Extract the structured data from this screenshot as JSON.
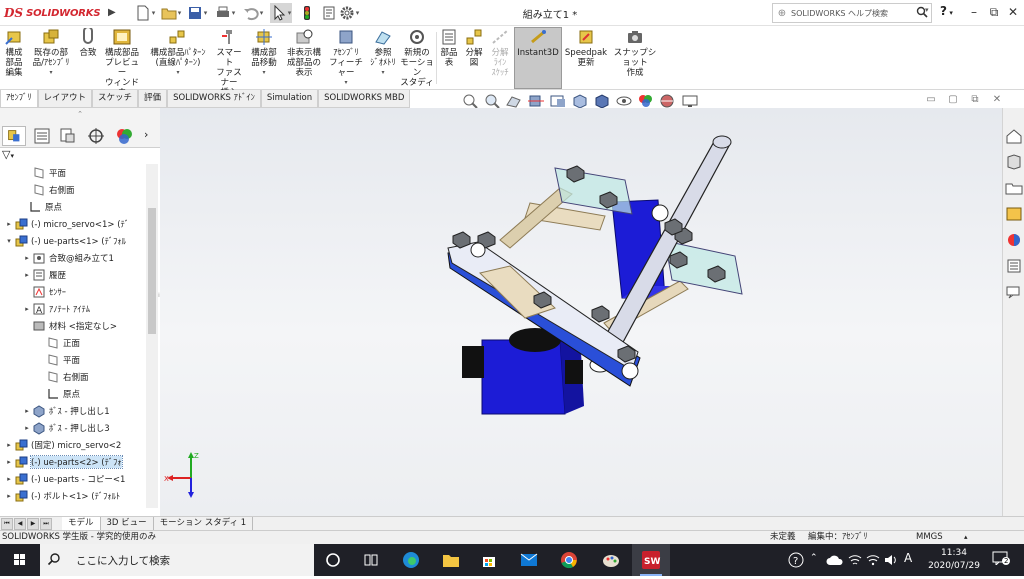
{
  "app": {
    "logo_mark": "DS",
    "logo_text": "SOLIDWORKS",
    "document_title": "組み立て1 *",
    "help_search_placeholder": "SOLIDWORKS ヘルプ検索",
    "help_label": "?",
    "accent_color": "#d3262f"
  },
  "ribbon": {
    "buttons": [
      {
        "label": "構成\n部品\n編集",
        "icon": "edit-component-icon"
      },
      {
        "label": "既存の部\n品/ｱｾﾝﾌﾞﾘ",
        "icon": "insert-component-icon"
      },
      {
        "label": "合致",
        "icon": "mate-icon"
      },
      {
        "label": "構成部品\nプレビュー\nウィンドウ",
        "icon": "preview-window-icon"
      },
      {
        "label": "構成部品ﾊﾟﾀｰﾝ\n(直線ﾊﾟﾀｰﾝ)",
        "icon": "linear-pattern-icon"
      },
      {
        "label": "スマート\nファスナー\n挿入",
        "icon": "smart-fastener-icon"
      },
      {
        "label": "構成部\n品移動",
        "icon": "move-component-icon"
      },
      {
        "label": "非表示構\n成部品の\n表示",
        "icon": "show-hidden-icon"
      },
      {
        "label": "ｱｾﾝﾌﾞﾘ\nフィーチャー",
        "icon": "assembly-feature-icon"
      },
      {
        "label": "参照\nｼﾞｵﾒﾄﾘ",
        "icon": "reference-geometry-icon"
      },
      {
        "label": "新規の\nモーション\nスタディ",
        "icon": "motion-study-icon"
      },
      {
        "label": "部品\n表",
        "icon": "bom-icon"
      },
      {
        "label": "分解\n図",
        "icon": "exploded-view-icon"
      },
      {
        "label": "分解\nﾗｲﾝ\nｽｹｯﾁ",
        "icon": "explode-line-icon"
      },
      {
        "label": "Instant3D",
        "icon": "instant3d-icon"
      },
      {
        "label": "Speedpak\n更新",
        "icon": "speedpak-icon"
      },
      {
        "label": "スナップショット\n作成",
        "icon": "snapshot-icon"
      }
    ]
  },
  "command_tabs": [
    "ｱｾﾝﾌﾞﾘ",
    "レイアウト",
    "スケッチ",
    "評価",
    "SOLIDWORKS ｱﾄﾞｲﾝ",
    "Simulation",
    "SOLIDWORKS MBD"
  ],
  "tree": {
    "nodes": [
      {
        "label": "平面",
        "expand": "",
        "icon": "plane-icon"
      },
      {
        "label": "右側面",
        "expand": "",
        "icon": "plane-icon"
      },
      {
        "label": "原点",
        "expand": "",
        "icon": "origin-icon"
      },
      {
        "label": "(-) micro_servo<1> (ﾃﾞ",
        "expand": "▸",
        "icon": "assembly-icon"
      },
      {
        "label": "(-) ue-parts<1> (ﾃﾞﾌｫﾙ",
        "expand": "▾",
        "icon": "assembly-icon"
      },
      {
        "label": "合致@組み立て1",
        "expand": "▸",
        "icon": "mate-folder-icon"
      },
      {
        "label": "履歴",
        "expand": "▸",
        "icon": "history-icon"
      },
      {
        "label": "ｾﾝｻｰ",
        "expand": "",
        "icon": "sensor-icon"
      },
      {
        "label": "ｱﾉﾃｰﾄ ｱｲﾃﾑ",
        "expand": "▸",
        "icon": "annotation-icon"
      },
      {
        "label": "材料 <指定なし>",
        "expand": "",
        "icon": "material-icon"
      },
      {
        "label": "正面",
        "expand": "",
        "icon": "plane-icon"
      },
      {
        "label": "平面",
        "expand": "",
        "icon": "plane-icon"
      },
      {
        "label": "右側面",
        "expand": "",
        "icon": "plane-icon"
      },
      {
        "label": "原点",
        "expand": "",
        "icon": "origin-icon"
      },
      {
        "label": "ﾎﾞｽ - 押し出し1",
        "expand": "▸",
        "icon": "extrude-icon"
      },
      {
        "label": "ﾎﾞｽ - 押し出し3",
        "expand": "▸",
        "icon": "extrude-icon"
      },
      {
        "label": "(固定) micro_servo<2",
        "expand": "▸",
        "icon": "assembly-icon"
      },
      {
        "label": "(-) ue-parts<2> (ﾃﾞﾌｫ",
        "expand": "▸",
        "icon": "assembly-icon"
      },
      {
        "label": "(-) ue-parts - コピー<1",
        "expand": "▸",
        "icon": "assembly-icon"
      },
      {
        "label": "(-) ボルト<1> (ﾃﾞﾌｫﾙﾄ",
        "expand": "▸",
        "icon": "assembly-icon"
      }
    ]
  },
  "bottom_tabs": [
    "モデル",
    "3D ビュー",
    "モーション スタディ 1"
  ],
  "status": {
    "left": "SOLIDWORKS 学生版 - 学究的使用のみ",
    "definition": "未定義",
    "editing": "編集中：ｱｾﾝﾌﾞﾘ",
    "units": "MMGS"
  },
  "taskbar": {
    "search_placeholder": "ここに入力して検索",
    "time": "11:34",
    "date": "2020/07/29",
    "ime": "A",
    "notifications": "2"
  }
}
